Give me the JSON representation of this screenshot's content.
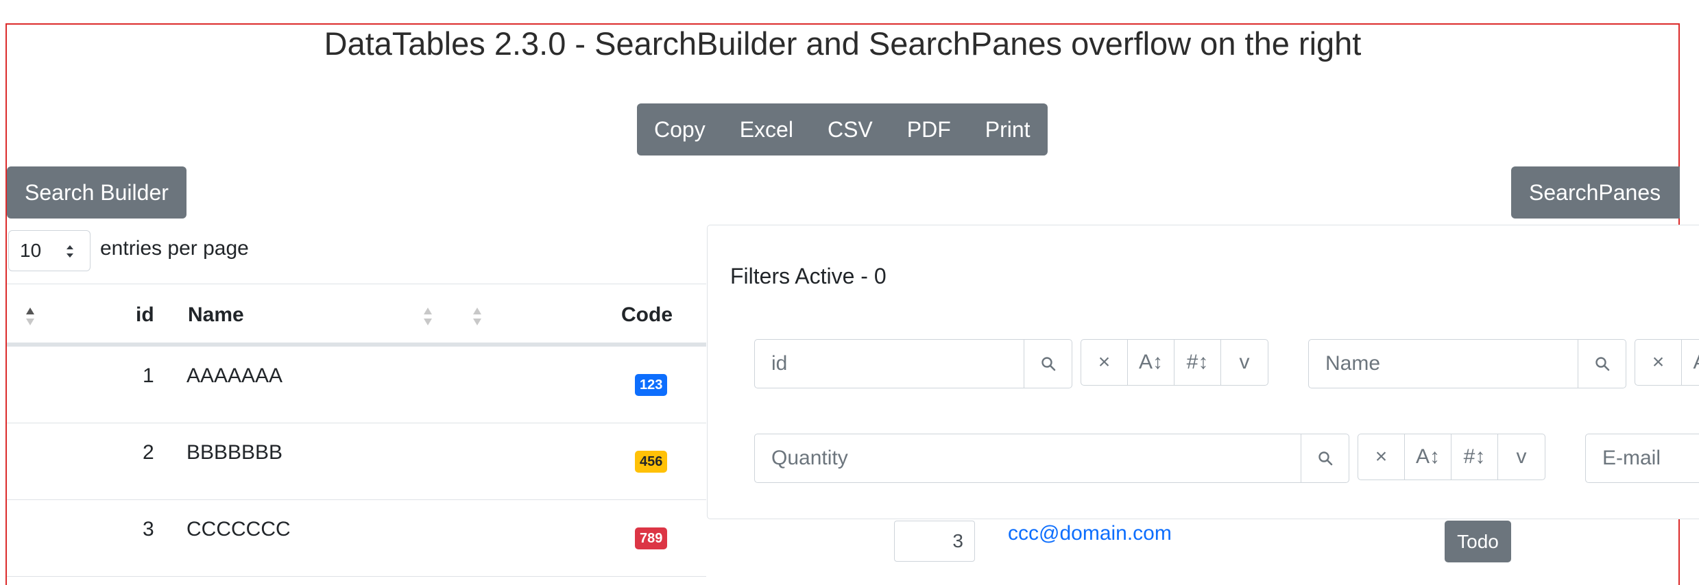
{
  "page": {
    "title": "DataTables 2.3.0 - SearchBuilder and SearchPanes overflow on the right"
  },
  "export_buttons": [
    "Copy",
    "Excel",
    "CSV",
    "PDF",
    "Print"
  ],
  "search_builder_label": "Search Builder",
  "search_panes_label": "SearchPanes",
  "length": {
    "value": "10",
    "label": "entries per page"
  },
  "table": {
    "headers": {
      "id": "id",
      "name": "Name",
      "code": "Code"
    },
    "rows": [
      {
        "id": "1",
        "name": "AAAAAAA",
        "code": "123",
        "code_color": "#0d6efd"
      },
      {
        "id": "2",
        "name": "BBBBBBB",
        "code": "456",
        "code_color": "#ffc107"
      },
      {
        "id": "3",
        "name": "CCCCCCC",
        "code": "789",
        "code_color": "#dc3545"
      }
    ],
    "row3_extra": {
      "quantity": "3",
      "email": "ccc@domain.com",
      "action": "Todo"
    }
  },
  "search_panes": {
    "filters_title": "Filters Active - 0",
    "panes": [
      {
        "placeholder": "id"
      },
      {
        "placeholder": "Name"
      },
      {
        "placeholder": "Quantity"
      },
      {
        "placeholder": "E-mail"
      }
    ],
    "tool_icons": {
      "clear": "×",
      "sort_alpha": "A↕",
      "sort_num": "#↕",
      "collapse": "v"
    }
  },
  "colors": {
    "button_gray": "#6c757d",
    "frame_red": "#dc2b2b",
    "link_blue": "#0d6efd"
  }
}
